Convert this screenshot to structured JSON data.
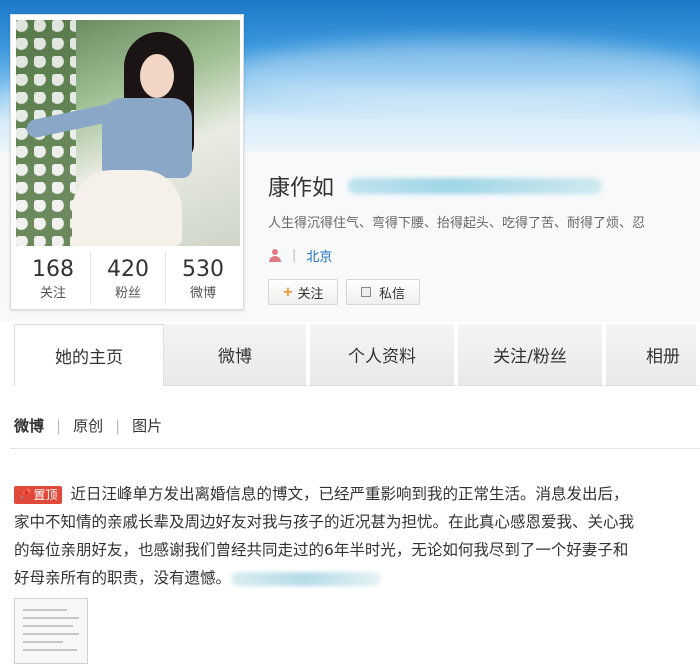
{
  "profile": {
    "name": "康作如",
    "bio": "人生得沉得住气、弯得下腰、抬得起头、吃得了苦、耐得了烦、忍",
    "location": "北京",
    "stats": [
      {
        "value": "168",
        "label": "关注"
      },
      {
        "value": "420",
        "label": "粉丝"
      },
      {
        "value": "530",
        "label": "微博"
      }
    ],
    "follow_label": "关注",
    "message_label": "私信"
  },
  "tabs": [
    {
      "label": "她的主页",
      "active": true
    },
    {
      "label": "微博"
    },
    {
      "label": "个人资料"
    },
    {
      "label": "关注/粉丝"
    },
    {
      "label": "相册"
    }
  ],
  "filters": [
    "微博",
    "原创",
    "图片"
  ],
  "post": {
    "pin_label": "置顶",
    "lines": [
      "近日汪峰单方发出离婚信息的博文，已经严重影响到我的正常生活。消息发出后，",
      "家中不知情的亲戚长辈及周边好友对我与孩子的近况甚为担忧。在此真心感恩爱我、关心我",
      "的每位亲朋好友，也感谢我们曾经共同走过的6年半时光，无论如何我尽到了一个好妻子和",
      "好母亲所有的职责，没有遗憾。"
    ]
  },
  "colors": {
    "pin": "#e14a3b",
    "link": "#1a6fbf",
    "follow_plus": "#f28c1a"
  }
}
